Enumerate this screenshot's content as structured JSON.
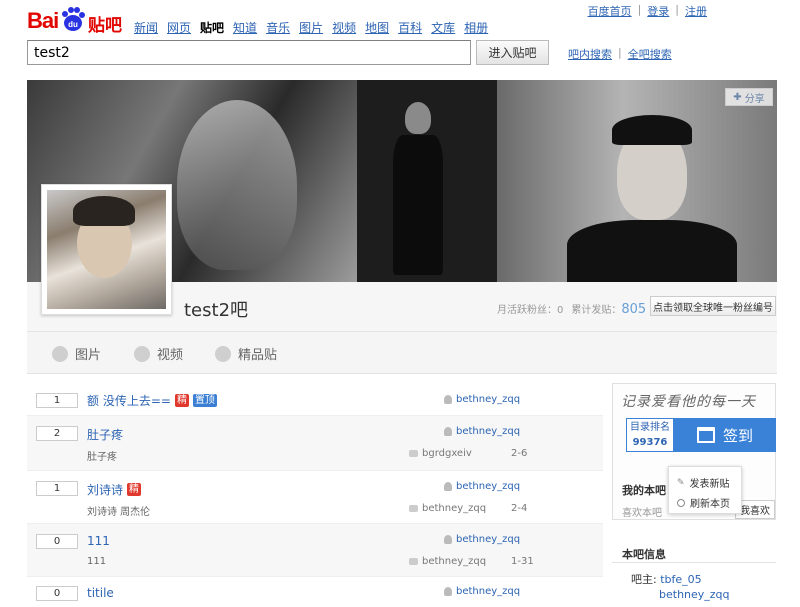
{
  "logo": {
    "bai": "Bai",
    "du": "du",
    "tieba": "贴吧"
  },
  "nav": {
    "items": [
      {
        "label": "新闻",
        "current": false
      },
      {
        "label": "网页",
        "current": false
      },
      {
        "label": "贴吧",
        "current": true
      },
      {
        "label": "知道",
        "current": false
      },
      {
        "label": "音乐",
        "current": false
      },
      {
        "label": "图片",
        "current": false
      },
      {
        "label": "视频",
        "current": false
      },
      {
        "label": "地图",
        "current": false
      },
      {
        "label": "百科",
        "current": false
      },
      {
        "label": "文库",
        "current": false
      },
      {
        "label": "相册",
        "current": false
      }
    ]
  },
  "top_links": {
    "home": "百度首页",
    "sep": "|",
    "login": "登录",
    "register": "注册"
  },
  "search": {
    "value": "test2",
    "button": "进入贴吧",
    "in_forum": "吧内搜索",
    "global": "全吧搜索",
    "sep": "|"
  },
  "banner": {
    "share": "分享"
  },
  "forum": {
    "name": "test2吧",
    "active_fans_label": "月活跃粉丝：",
    "active_fans": "0",
    "total_posts_label": "累计发贴：",
    "total_posts": "805",
    "fan_button": "点击领取全球唯一粉丝编号"
  },
  "tabs": [
    {
      "label": "图片",
      "icon": "picture-icon"
    },
    {
      "label": "视频",
      "icon": "video-icon"
    },
    {
      "label": "精品贴",
      "icon": "star-icon"
    }
  ],
  "threads": [
    {
      "replies": "1",
      "title": "额 没传上去==",
      "badges": [
        "精",
        "置顶"
      ],
      "author": "bethney_zqq",
      "abstract": "",
      "last_reply": "",
      "date": ""
    },
    {
      "replies": "2",
      "title": "肚子疼",
      "badges": [],
      "author": "bethney_zqq",
      "abstract": "肚子疼",
      "last_reply": "bgrdgxeiv",
      "date": "2-6"
    },
    {
      "replies": "1",
      "title": "刘诗诗",
      "badges": [
        "精"
      ],
      "author": "bethney_zqq",
      "abstract": "刘诗诗 周杰伦",
      "last_reply": "bethney_zqq",
      "date": "2-4"
    },
    {
      "replies": "0",
      "title": "111",
      "badges": [],
      "author": "bethney_zqq",
      "abstract": "111",
      "last_reply": "bethney_zqq",
      "date": "1-31"
    },
    {
      "replies": "0",
      "title": "titile",
      "badges": [],
      "author": "bethney_zqq",
      "abstract": "",
      "last_reply": "",
      "date": ""
    }
  ],
  "aside": {
    "slogan": "记录爱看他的每一天",
    "rank_label": "目录排名",
    "rank_value": "99376",
    "sign_button": "签到",
    "my_forum": "我的本吧",
    "like_hint": "喜欢本吧",
    "like_button": "我喜欢",
    "popup": {
      "new_post": "发表新贴",
      "refresh": "刷新本页"
    },
    "info_title": "本吧信息",
    "owner_label": "吧主:",
    "owners": [
      "tbfe_05",
      "bethney_zqq"
    ]
  },
  "colors": {
    "brand_red": "#e10602",
    "link_blue": "#2d64b3",
    "sign_blue": "#3a82d8"
  }
}
